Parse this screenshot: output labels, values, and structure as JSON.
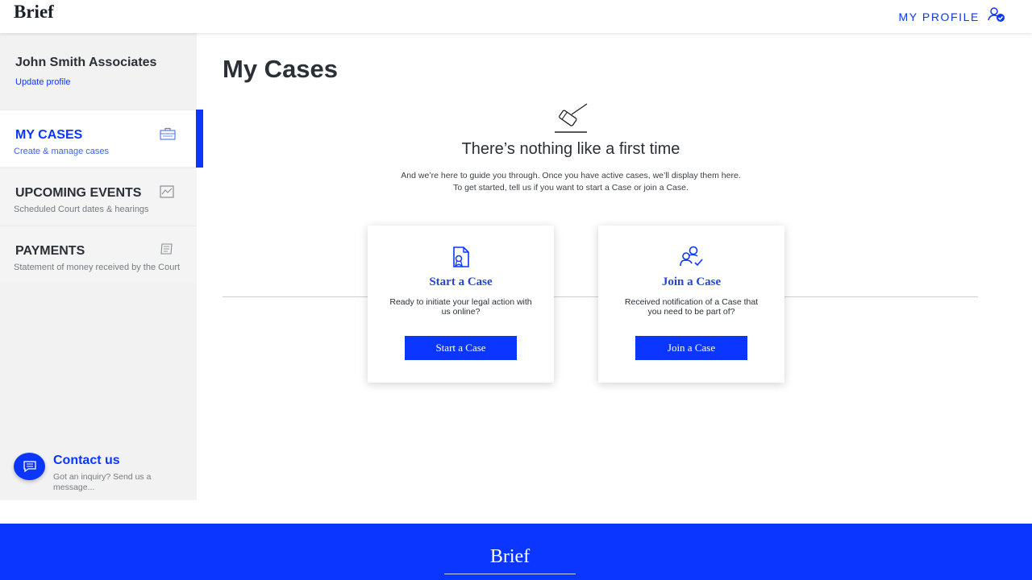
{
  "header": {
    "logo": "Brief",
    "profile_label": "MY PROFILE",
    "profile_icon": "user-check-icon"
  },
  "sidebar": {
    "account_name": "John Smith Associates",
    "account_link": "Update profile",
    "items": [
      {
        "title": "MY CASES",
        "subtitle": "Create & manage cases",
        "icon": "briefcase-icon",
        "active": true
      },
      {
        "title": "UPCOMING EVENTS",
        "subtitle": "Scheduled Court dates & hearings",
        "icon": "calendar-icon",
        "active": false
      },
      {
        "title": "PAYMENTS",
        "subtitle": "Statement of money received by the Court",
        "icon": "receipt-icon",
        "active": false
      }
    ],
    "contact": {
      "title": "Contact us",
      "subtitle": "Got an inquiry? Send us a message...",
      "icon": "chat-icon"
    }
  },
  "main": {
    "title": "My Cases",
    "empty_state": {
      "icon": "gavel-icon",
      "title": "There’s nothing like a first time",
      "line1": "And we’re here to guide you through. Once you have active cases, we’ll display them here.",
      "line2": "To get started, tell us if you want to start a Case or join a Case."
    },
    "cards": [
      {
        "icon": "document-certificate-icon",
        "title": "Start a Case",
        "description": "Ready to initiate your legal action with us online?",
        "button": "Start a Case"
      },
      {
        "icon": "users-check-icon",
        "title": "Join a Case",
        "description": "Received notification of a Case that you need to be part of?",
        "button": "Join a Case"
      }
    ]
  },
  "footer": {
    "logo": "Brief"
  },
  "colors": {
    "accent": "#0a36ff",
    "sidebar_bg": "#f2f2f2",
    "text": "#2b2f36"
  }
}
